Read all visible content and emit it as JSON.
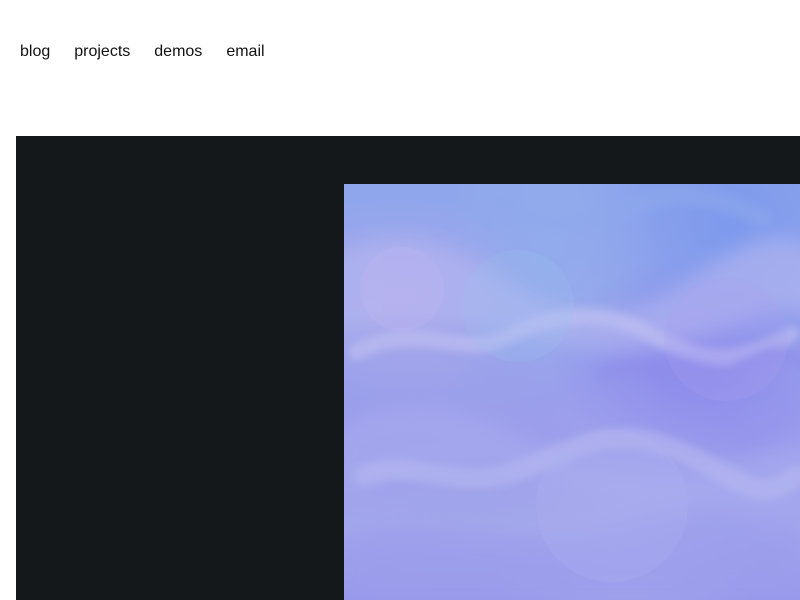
{
  "nav": {
    "items": [
      {
        "label": "blog"
      },
      {
        "label": "projects"
      },
      {
        "label": "demos"
      },
      {
        "label": "email"
      }
    ]
  },
  "colors": {
    "page_background": "#ffffff",
    "nav_text": "#111111",
    "hero_background": "#15181b",
    "image_palette": [
      "#8fa6ec",
      "#9999ec",
      "#a3a7ec",
      "#7894ed"
    ]
  },
  "hero": {
    "image_subject": "blue-violet watercolor-like cloud texture"
  }
}
